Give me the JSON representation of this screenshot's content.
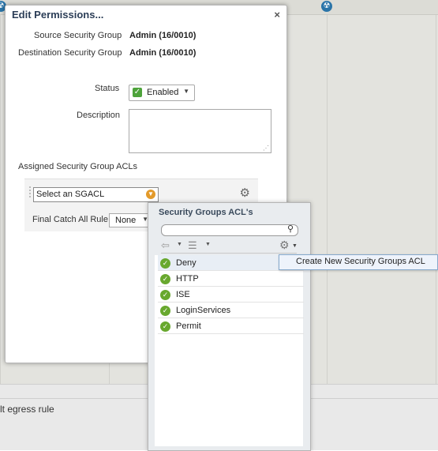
{
  "dialog": {
    "title": "Edit Permissions...",
    "close_glyph": "×",
    "source_label": "Source Security Group",
    "source_value": "Admin (16/0010)",
    "destination_label": "Destination Security Group",
    "destination_value": "Admin (16/0010)",
    "status_label": "Status",
    "status_value": "Enabled",
    "description_label": "Description",
    "description_value": "",
    "acl_heading": "Assigned Security Group ACLs",
    "sgacl_placeholder": "Select an SGACL",
    "final_rule_label": "Final Catch All Rule",
    "final_rule_value": "None"
  },
  "popup": {
    "title": "Security Groups ACL's",
    "search_value": "",
    "items": [
      {
        "label": "Deny"
      },
      {
        "label": "HTTP"
      },
      {
        "label": "ISE"
      },
      {
        "label": "LoginServices"
      },
      {
        "label": "Permit"
      }
    ]
  },
  "context_menu": {
    "item": "Create New Security Groups ACL"
  },
  "background": {
    "egress_text": "lt egress rule"
  },
  "icons": {
    "close": "close-icon",
    "check": "check-icon",
    "dropdown": "chevron-down-icon",
    "gear": "gear-icon",
    "search": "search-icon",
    "back": "back-arrow-icon",
    "list": "list-icon",
    "status_ok": "check-circle-icon",
    "radiation": "radiation-icon"
  },
  "colors": {
    "status_green": "#4ea33b",
    "item_green": "#68a82e",
    "select_orange": "#e39a2a",
    "title_blue": "#2c3e57",
    "menu_highlight": "#eef3fb"
  }
}
